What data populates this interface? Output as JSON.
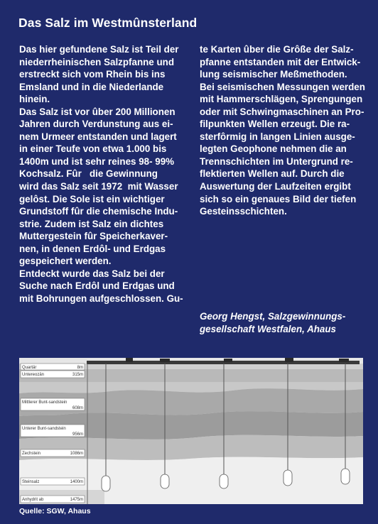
{
  "title": "Das Salz im Westmûnsterland",
  "left_column": [
    "Das hier gefundene Salz ist Teil der",
    "niederrheinischen Salzpfanne und",
    "erstreckt sich vom Rhein bis ins",
    "Emsland und in die Niederlande",
    "hinein.",
    "Das Salz ist vor ûber 200 Millionen",
    "Jahren durch Verdunstung aus ei-",
    "nem Urmeer entstanden und lagert",
    "in einer Teufe von etwa 1.000 bis",
    "1400m und ist sehr reines 98- 99%",
    "Kochsalz. Fûr   die Gewinnung",
    "wird das Salz seit 1972  mit Wasser",
    "gelôst. Die Sole ist ein wichtiger",
    "Grundstoff fûr die chemische Indu-",
    "strie. Zudem ist Salz ein dichtes",
    "Muttergestein fûr Speicherkaver-",
    "nen, in denen Erdôl- und Erdgas",
    "gespeichert werden.",
    "Entdeckt wurde das Salz bei der",
    "Suche nach Erdôl und Erdgas und",
    "mit Bohrungen aufgeschlossen. Gu-"
  ],
  "right_column": [
    "te Karten ûber die Grôße der Salz-",
    "pfanne entstanden mit der Entwick-",
    "lung seismischer Meßmethoden.",
    "Bei seismischen Messungen werden",
    "mit Hammerschlägen, Sprengungen",
    "oder mit Schwingmaschinen an Pro-",
    "filpunkten Wellen erzeugt. Die ra-",
    "sterfôrmig in langen Linien ausge-",
    "legten Geophone nehmen die an",
    "Trennschichten im Untergrund re-",
    "flektierten Wellen auf. Durch die",
    "Auswertung der Laufzeiten ergibt",
    "sich so ein genaues Bild der tiefen",
    "Gesteinsschichten."
  ],
  "signature": [
    "Georg Hengst, Salzgewinnungs-",
    "gesellschaft Westfalen, Ahaus"
  ],
  "figure": {
    "layers": [
      {
        "name": "Quartär",
        "depth": "8m"
      },
      {
        "name": "Untereozän",
        "depth": "315m"
      },
      {
        "name": "Mittlerer Bunt-sandstein",
        "depth": "608m"
      },
      {
        "name": "Unterer Bunt-sandstein",
        "depth": "956m"
      },
      {
        "name": "Zechstein",
        "depth": "1086m"
      },
      {
        "name": "Steinsalz",
        "depth": "1400m"
      },
      {
        "name": "Anhydrit ab",
        "depth": "1475m"
      }
    ]
  },
  "source": "Quelle: SGW, Ahaus",
  "colors": {
    "background": "#1f2a6b",
    "text": "#ffffff"
  }
}
